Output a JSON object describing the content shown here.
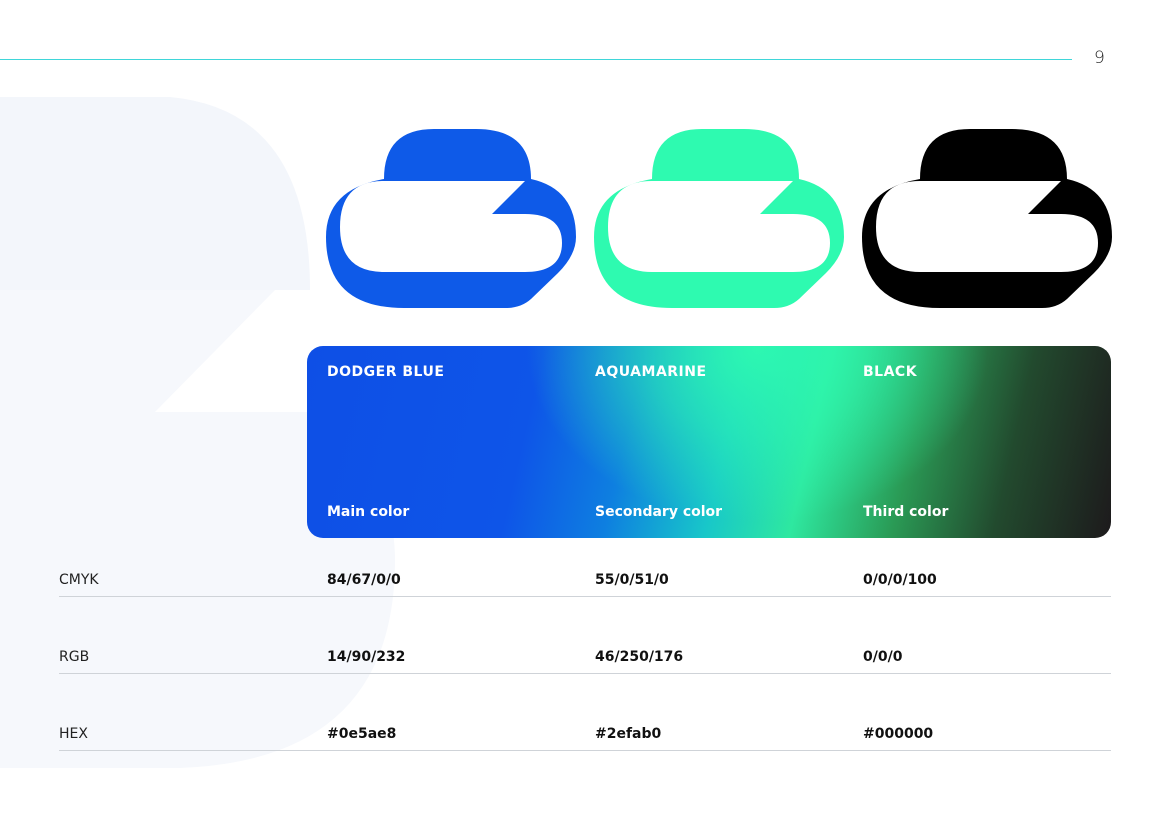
{
  "page": {
    "number": "9"
  },
  "colors": [
    {
      "name": "DODGER BLUE",
      "role": "Main color",
      "hex_swatch": "#0e5ae8",
      "cmyk": "84/67/0/0",
      "rgb": "14/90/232",
      "hex": "#0e5ae8"
    },
    {
      "name": "AQUAMARINE",
      "role": "Secondary color",
      "hex_swatch": "#2efab0",
      "cmyk": "55/0/51/0",
      "rgb": "46/250/176",
      "hex": "#2efab0"
    },
    {
      "name": "BLACK",
      "role": "Third color",
      "hex_swatch": "#000000",
      "cmyk": "0/0/0/100",
      "rgb": "0/0/0",
      "hex": "#000000"
    }
  ],
  "spec_labels": {
    "cmyk": "CMYK",
    "rgb": "RGB",
    "hex": "HEX"
  },
  "icons": {
    "logo": "cloud-logo-icon"
  }
}
